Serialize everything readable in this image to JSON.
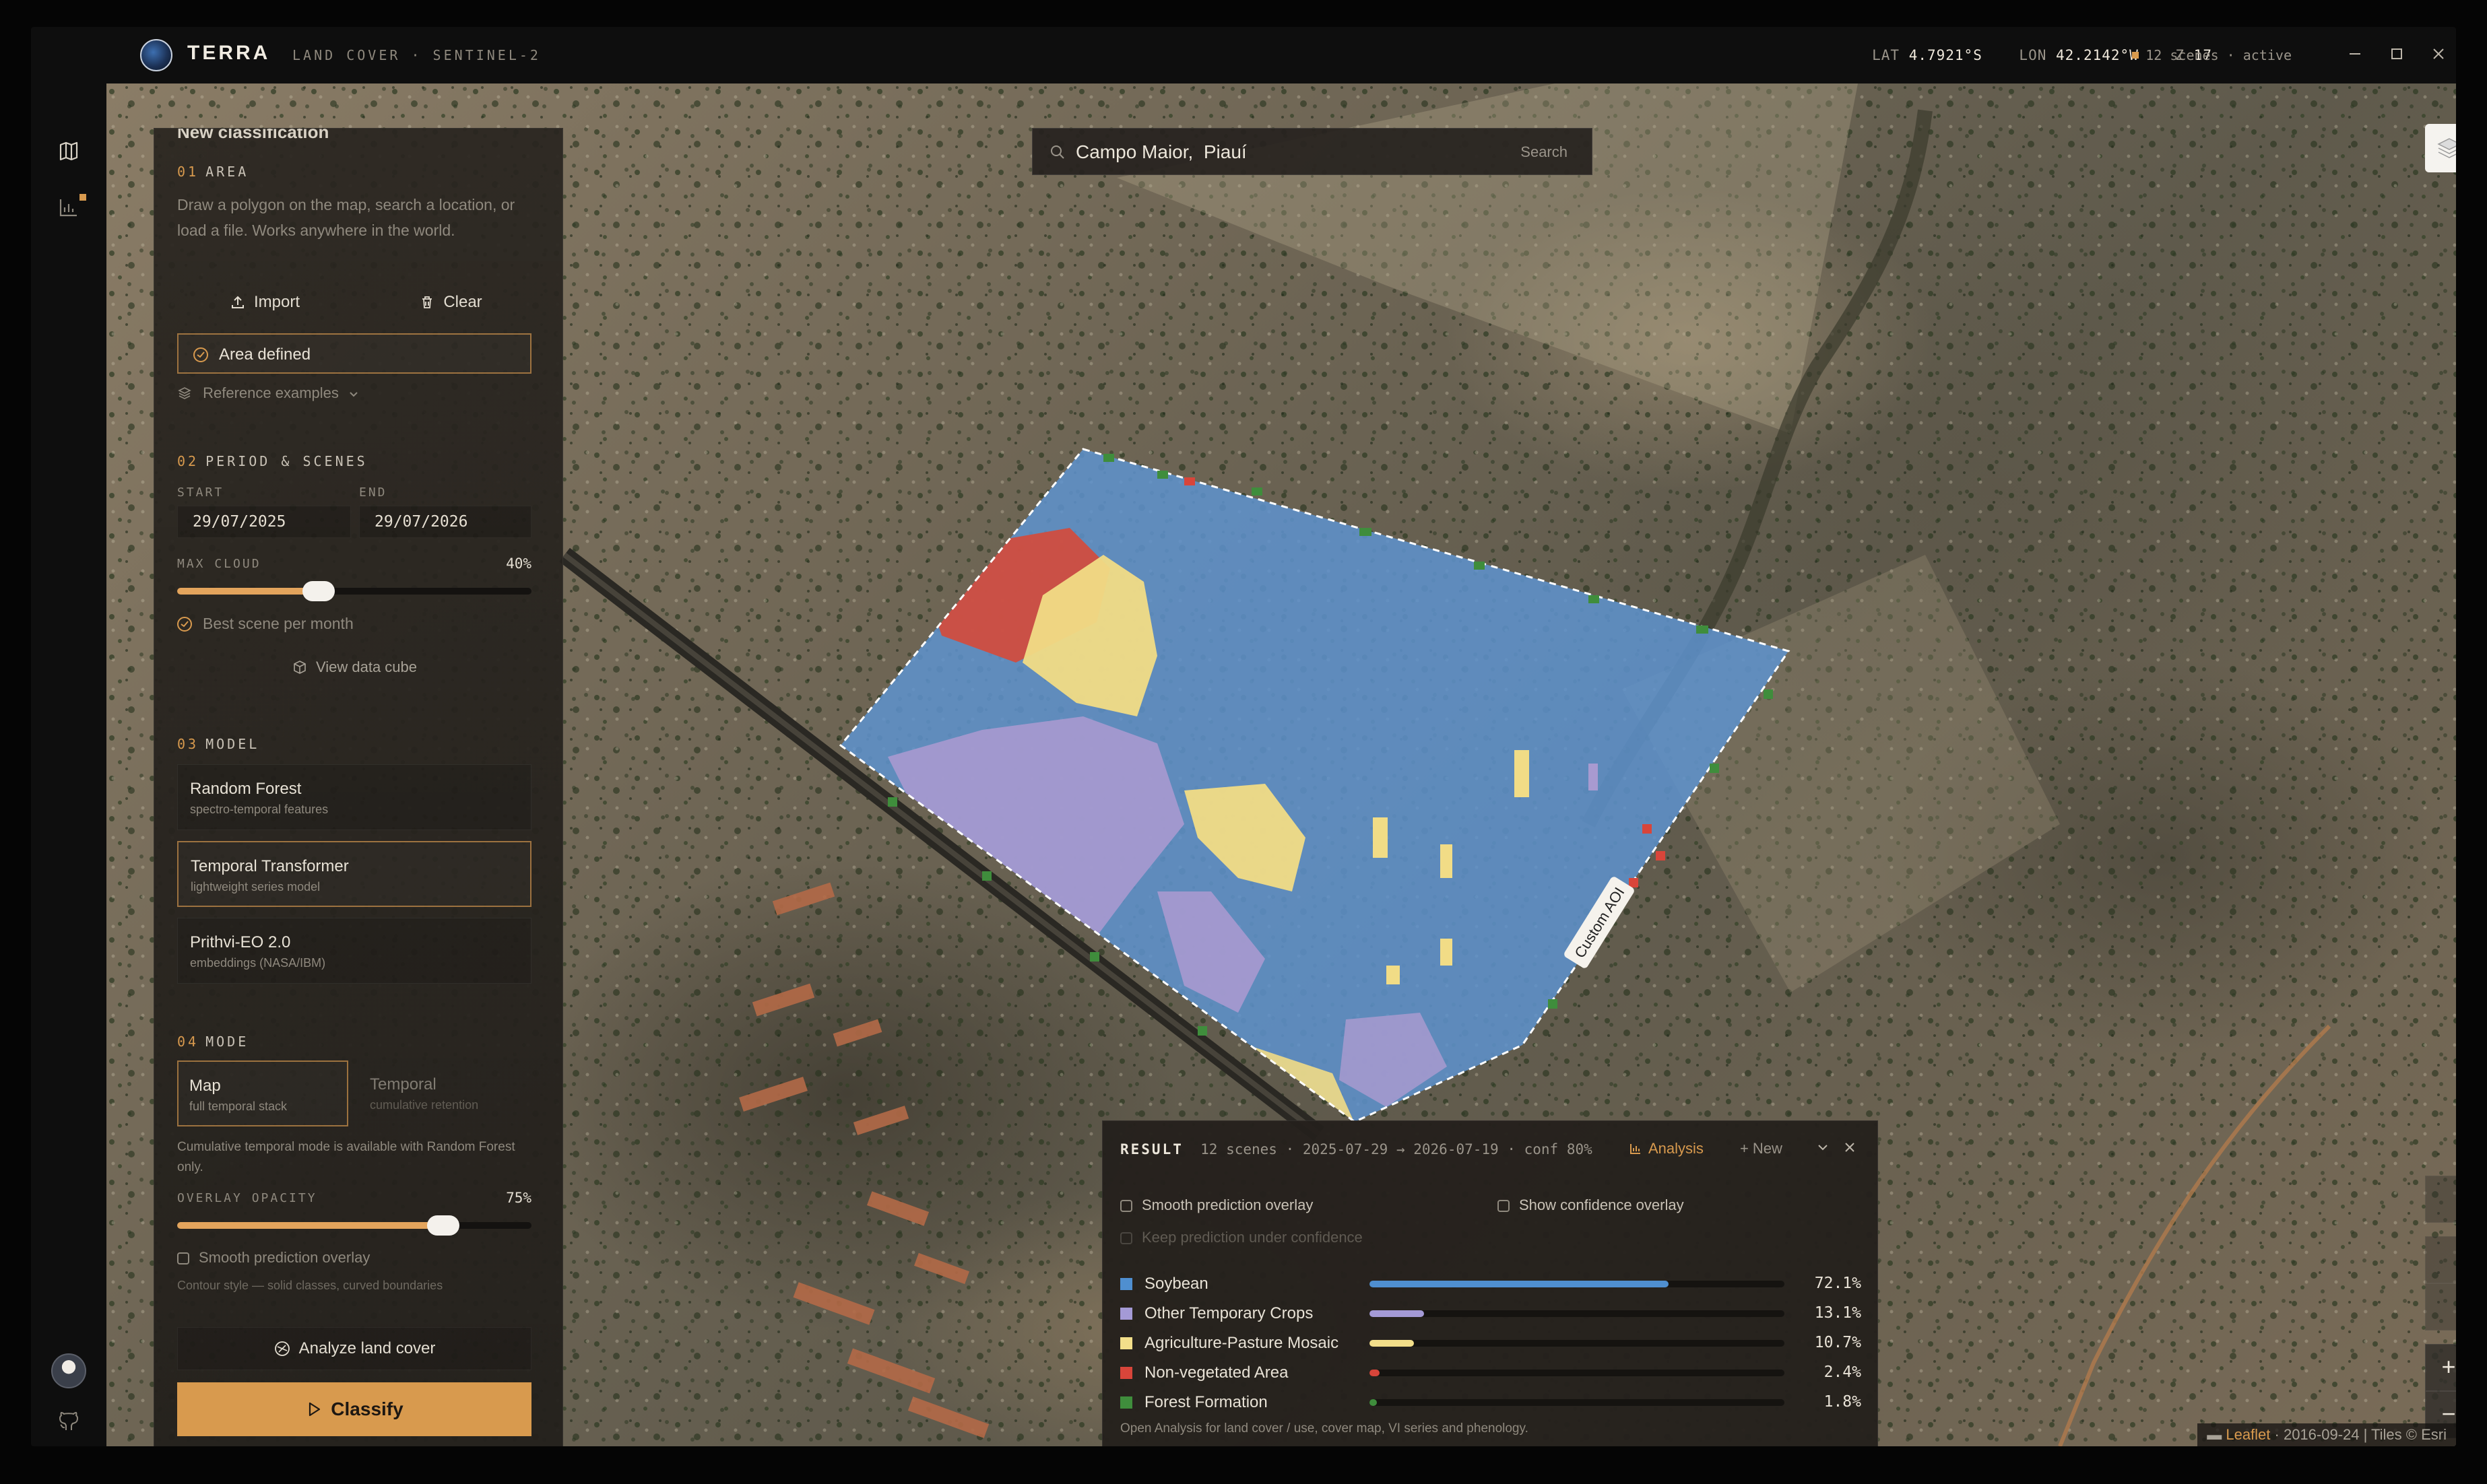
{
  "app": {
    "brand": "TERRA",
    "subtitle": "LAND COVER · SENTINEL-2"
  },
  "topbar": {
    "lat_label": "LAT",
    "lat_value": "4.7921°S",
    "lon_label": "LON",
    "lon_value": "42.2142°W",
    "zoom_label": "Z",
    "zoom_value": "17",
    "status": "12 scenes · active",
    "colors": {
      "accent": "#d89a4e"
    }
  },
  "panel": {
    "header": "New classification",
    "area": {
      "num": "01",
      "title": "AREA",
      "help": "Draw a polygon on the map, search a location, or load a file. Works anywhere in the world.",
      "import_label": "Import",
      "clear_label": "Clear",
      "status": "Area defined",
      "examples_label": "Reference examples"
    },
    "period": {
      "num": "02",
      "title": "PERIOD & SCENES",
      "start_label": "START",
      "start_value": "29/07/2025",
      "end_label": "END",
      "end_value": "29/07/2026",
      "cloud_label": "MAX CLOUD",
      "cloud_value": "40%",
      "cloud_fraction": 0.4,
      "best_scene": "Best scene per month",
      "cube_label": "View data cube"
    },
    "model": {
      "num": "03",
      "title": "MODEL",
      "options": [
        {
          "name": "Random Forest",
          "desc": "spectro-temporal features"
        },
        {
          "name": "Temporal Transformer",
          "desc": "lightweight series model"
        },
        {
          "name": "Prithvi-EO 2.0",
          "desc": "embeddings (NASA/IBM)"
        }
      ]
    },
    "mode": {
      "num": "04",
      "title": "MODE",
      "options": [
        {
          "name": "Map",
          "desc": "full temporal stack"
        },
        {
          "name": "Temporal",
          "desc": "cumulative retention"
        }
      ],
      "note": "Cumulative temporal mode is available with Random Forest only.",
      "opacity_label": "OVERLAY OPACITY",
      "opacity_value": "75%",
      "opacity_fraction": 0.75,
      "smooth_label": "Smooth prediction overlay",
      "smooth_note": "Contour style — solid classes, curved boundaries"
    },
    "analyze_label": "Analyze land cover",
    "classify_label": "Classify"
  },
  "search": {
    "value": "Campo Maior,  Piauí",
    "button": "Search"
  },
  "map": {
    "aoi_label": "Custom AOI"
  },
  "result": {
    "title": "RESULT",
    "scenes": "12 scenes",
    "range": "2025-07-29 → 2026-07-19",
    "conf": "conf 80%",
    "analysis_label": "Analysis",
    "new_label": "New",
    "smooth_label": "Smooth prediction overlay",
    "confidence_label": "Show confidence overlay",
    "keep_label": "Keep prediction under confidence",
    "classes": [
      {
        "name": "Soybean",
        "pct": "72.1%",
        "value": 72.1,
        "color": "#4f8fd0"
      },
      {
        "name": "Other Temporary Crops",
        "pct": "13.1%",
        "value": 13.1,
        "color": "#a49ad6"
      },
      {
        "name": "Agriculture-Pasture Mosaic",
        "pct": "10.7%",
        "value": 10.7,
        "color": "#f3df8a"
      },
      {
        "name": "Non-vegetated Area",
        "pct": "2.4%",
        "value": 2.4,
        "color": "#d8453a"
      },
      {
        "name": "Forest Formation",
        "pct": "1.8%",
        "value": 1.8,
        "color": "#3f8d3c"
      }
    ],
    "footer": "Open Analysis for land cover / use, cover map, VI series and phenology."
  },
  "attribution": {
    "leaflet": "Leaflet",
    "rest": " · 2016-09-24 | Tiles © Esri"
  }
}
